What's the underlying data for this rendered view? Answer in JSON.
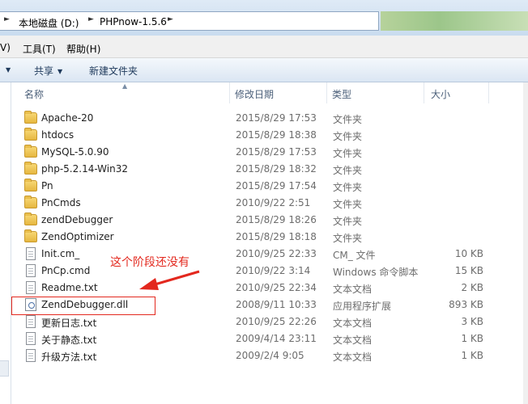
{
  "address_bar": {
    "crumbs": [
      "本地磁盘 (D:)",
      "PHPnow-1.5.6"
    ]
  },
  "menu": {
    "partial_view": "V)",
    "tools": "工具(T)",
    "help": "帮助(H)"
  },
  "toolbar": {
    "share_label": "共享",
    "new_folder_label": "新建文件夹"
  },
  "columns": {
    "name": "名称",
    "date": "修改日期",
    "type": "类型",
    "size": "大小"
  },
  "files": [
    {
      "name": "Apache-20",
      "date": "2015/8/29 17:53",
      "type": "文件夹",
      "size": "",
      "kind": "folder"
    },
    {
      "name": "htdocs",
      "date": "2015/8/29 18:38",
      "type": "文件夹",
      "size": "",
      "kind": "folder"
    },
    {
      "name": "MySQL-5.0.90",
      "date": "2015/8/29 17:53",
      "type": "文件夹",
      "size": "",
      "kind": "folder"
    },
    {
      "name": "php-5.2.14-Win32",
      "date": "2015/8/29 18:32",
      "type": "文件夹",
      "size": "",
      "kind": "folder"
    },
    {
      "name": "Pn",
      "date": "2015/8/29 17:54",
      "type": "文件夹",
      "size": "",
      "kind": "folder"
    },
    {
      "name": "PnCmds",
      "date": "2010/9/22 2:51",
      "type": "文件夹",
      "size": "",
      "kind": "folder"
    },
    {
      "name": "zendDebugger",
      "date": "2015/8/29 18:26",
      "type": "文件夹",
      "size": "",
      "kind": "folder"
    },
    {
      "name": "ZendOptimizer",
      "date": "2015/8/29 18:18",
      "type": "文件夹",
      "size": "",
      "kind": "folder"
    },
    {
      "name": "Init.cm_",
      "date": "2010/9/25 22:33",
      "type": "CM_ 文件",
      "size": "10 KB",
      "kind": "file"
    },
    {
      "name": "PnCp.cmd",
      "date": "2010/9/22 3:14",
      "type": "Windows 命令脚本",
      "size": "15 KB",
      "kind": "file"
    },
    {
      "name": "Readme.txt",
      "date": "2010/9/25 22:34",
      "type": "文本文档",
      "size": "2 KB",
      "kind": "file"
    },
    {
      "name": "ZendDebugger.dll",
      "date": "2008/9/11 10:33",
      "type": "应用程序扩展",
      "size": "893 KB",
      "kind": "dll"
    },
    {
      "name": "更新日志.txt",
      "date": "2010/9/25 22:26",
      "type": "文本文档",
      "size": "3 KB",
      "kind": "file"
    },
    {
      "name": "关于静态.txt",
      "date": "2009/4/14 23:11",
      "type": "文本文档",
      "size": "1 KB",
      "kind": "file"
    },
    {
      "name": "升级方法.txt",
      "date": "2009/2/4 9:05",
      "type": "文本文档",
      "size": "1 KB",
      "kind": "file"
    }
  ],
  "annotation": {
    "text": "这个阶段还没有",
    "color": "#e3281e"
  }
}
